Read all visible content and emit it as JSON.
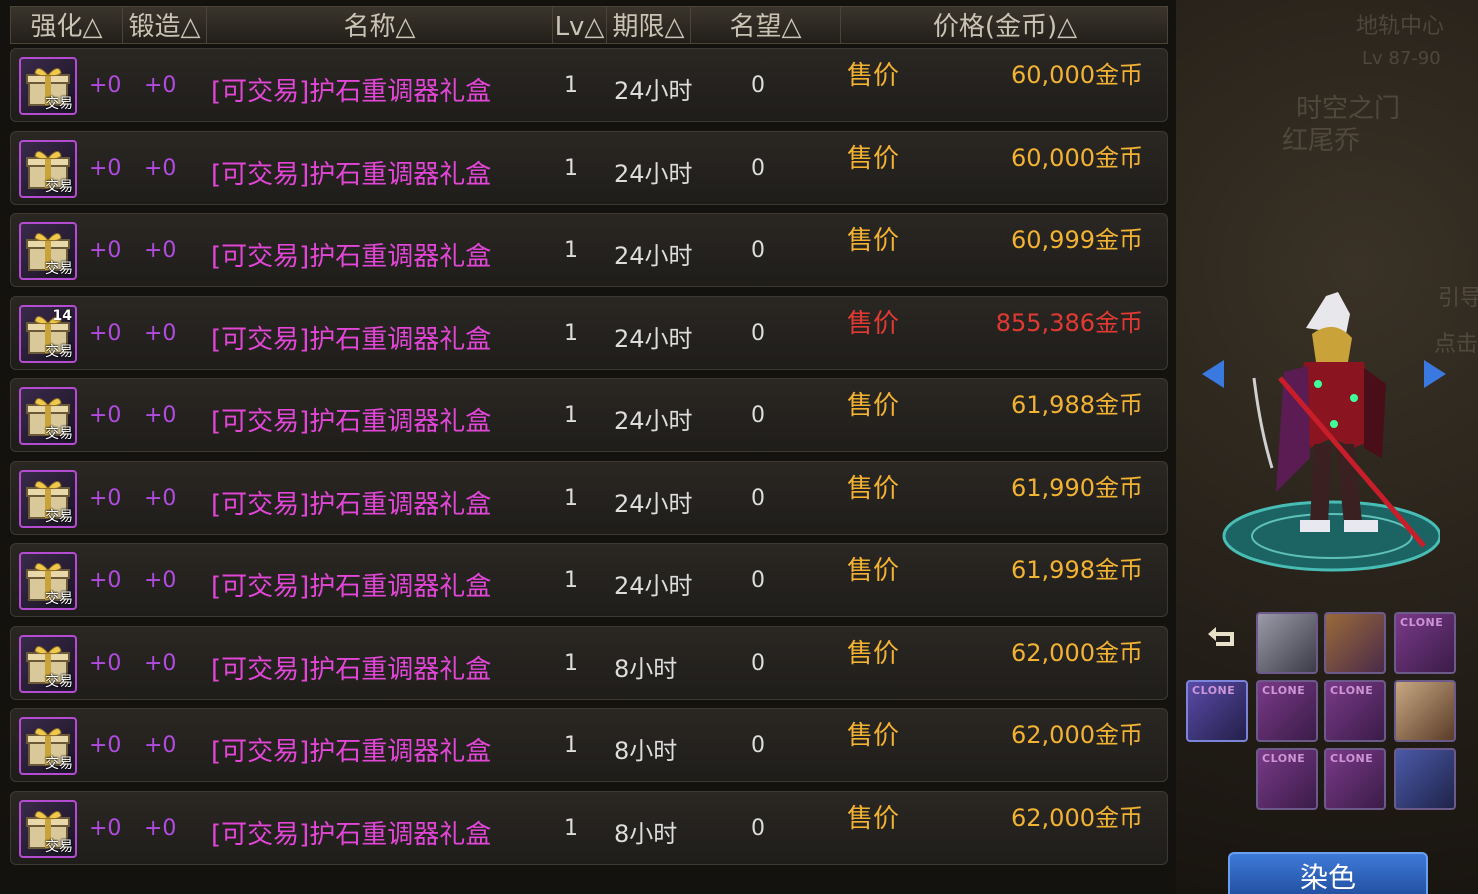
{
  "columns": {
    "strength": "强化△",
    "forge": "锻造△",
    "name": "名称△",
    "level": "Lv△",
    "period": "期限△",
    "fame": "名望△",
    "price": "价格(金币)△"
  },
  "price_label": "售价",
  "item_tag": "交易",
  "rows": [
    {
      "strength": "+0",
      "forge": "+0",
      "name": "[可交易]护石重调器礼盒",
      "level": "1",
      "period": "24小时",
      "fame": "0",
      "price": "60,000金币",
      "count": ""
    },
    {
      "strength": "+0",
      "forge": "+0",
      "name": "[可交易]护石重调器礼盒",
      "level": "1",
      "period": "24小时",
      "fame": "0",
      "price": "60,000金币",
      "count": ""
    },
    {
      "strength": "+0",
      "forge": "+0",
      "name": "[可交易]护石重调器礼盒",
      "level": "1",
      "period": "24小时",
      "fame": "0",
      "price": "60,999金币",
      "count": ""
    },
    {
      "strength": "+0",
      "forge": "+0",
      "name": "[可交易]护石重调器礼盒",
      "level": "1",
      "period": "24小时",
      "fame": "0",
      "price": "855,386金币",
      "count": "14"
    },
    {
      "strength": "+0",
      "forge": "+0",
      "name": "[可交易]护石重调器礼盒",
      "level": "1",
      "period": "24小时",
      "fame": "0",
      "price": "61,988金币",
      "count": ""
    },
    {
      "strength": "+0",
      "forge": "+0",
      "name": "[可交易]护石重调器礼盒",
      "level": "1",
      "period": "24小时",
      "fame": "0",
      "price": "61,990金币",
      "count": ""
    },
    {
      "strength": "+0",
      "forge": "+0",
      "name": "[可交易]护石重调器礼盒",
      "level": "1",
      "period": "24小时",
      "fame": "0",
      "price": "61,998金币",
      "count": ""
    },
    {
      "strength": "+0",
      "forge": "+0",
      "name": "[可交易]护石重调器礼盒",
      "level": "1",
      "period": "8小时",
      "fame": "0",
      "price": "62,000金币",
      "count": ""
    },
    {
      "strength": "+0",
      "forge": "+0",
      "name": "[可交易]护石重调器礼盒",
      "level": "1",
      "period": "8小时",
      "fame": "0",
      "price": "62,000金币",
      "count": ""
    },
    {
      "strength": "+0",
      "forge": "+0",
      "name": "[可交易]护石重调器礼盒",
      "level": "1",
      "period": "8小时",
      "fame": "0",
      "price": "62,000金币",
      "count": ""
    }
  ],
  "side": {
    "map_title": "地轨中心",
    "map_level": "Lv 87-90",
    "map_zone": "时空之门",
    "map_sub": "红尾乔",
    "hint_1": "引导",
    "hint_2": "点击",
    "clone_tag": "CLONE",
    "dye_button": "染色"
  },
  "colors": {
    "normal_price": "#f2b233",
    "highlight_price": "#e23a33",
    "item_name": "#e146d6",
    "enhance_value": "#b24be0"
  }
}
